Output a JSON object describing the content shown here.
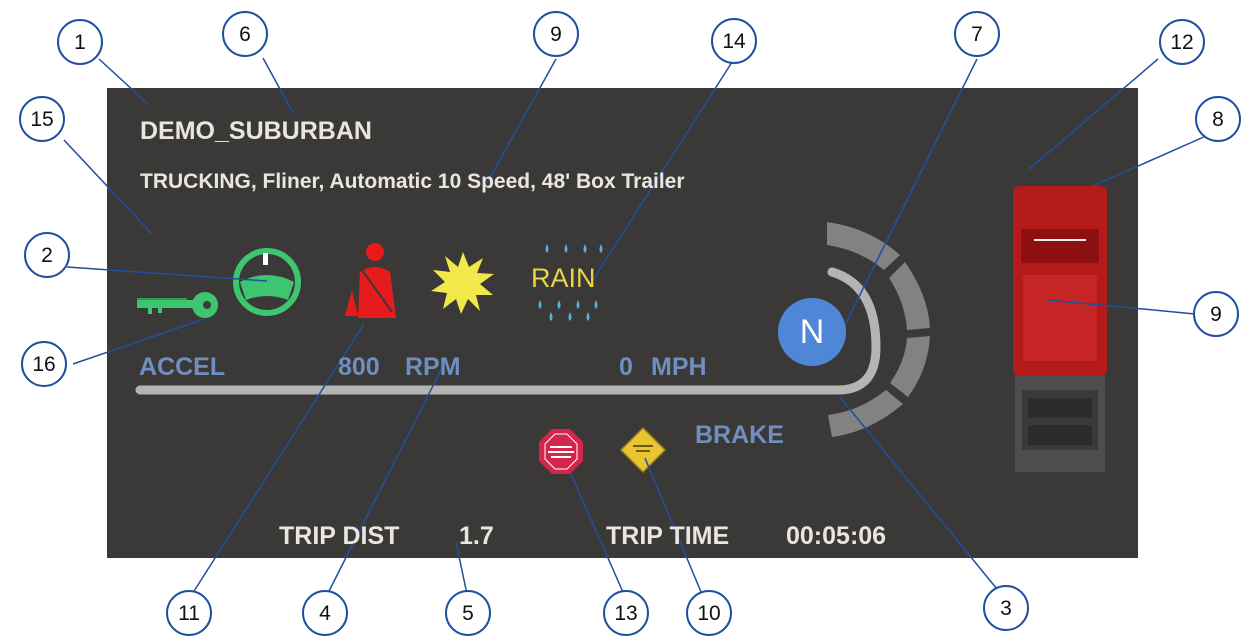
{
  "scenario": "DEMO_SUBURBAN",
  "vehicle_description": "TRUCKING, Fliner, Automatic 10 Speed, 48' Box Trailer",
  "weather": "RAIN",
  "gear": "N",
  "accel_label": "ACCEL",
  "rpm": {
    "value": "800",
    "unit": "RPM"
  },
  "speed": {
    "value": "0",
    "unit": "MPH"
  },
  "brake_label": "BRAKE",
  "trip_dist": {
    "label": "TRIP DIST",
    "value": "1.7"
  },
  "trip_time": {
    "label": "TRIP TIME",
    "value": "00:05:06"
  },
  "icons": {
    "ignition": "key-icon",
    "steering": "steering-wheel-icon",
    "seatbelt": "seatbelt-warning-icon",
    "sun": "sun-icon",
    "rain": "rain-icon",
    "trailer_air_supply": "trailer-air-supply-icon",
    "parking_brake": "parking-brake-icon",
    "vehicle": "truck-top-view-icon"
  },
  "colors": {
    "panel": "#3b3937",
    "label_blue": "#6f8fc0",
    "key_green": "#3ec56f",
    "seatbelt_red": "#e61b1b",
    "sun_yellow": "#f2e84a",
    "gear_blue": "#4f86d6",
    "truck_red": "#b51a1a"
  },
  "callouts": [
    "1",
    "6",
    "9",
    "14",
    "7",
    "12",
    "8",
    "15",
    "2",
    "16",
    "9",
    "11",
    "4",
    "5",
    "13",
    "10",
    "3"
  ]
}
